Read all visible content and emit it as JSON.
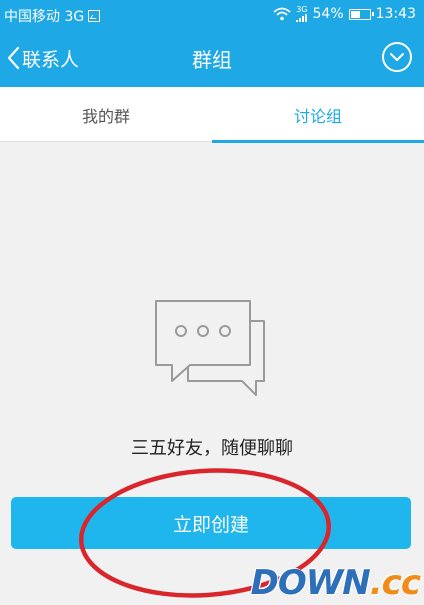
{
  "status_bar": {
    "carrier": "中国移动 3G",
    "net_type": "3G",
    "battery": "54%",
    "time": "13:43"
  },
  "header": {
    "back_label": "联系人",
    "title": "群组"
  },
  "tabs": [
    {
      "label": "我的群",
      "active": false
    },
    {
      "label": "讨论组",
      "active": true
    }
  ],
  "empty_state": {
    "message": "三五好友，随便聊聊",
    "icon": "chat-bubbles-icon"
  },
  "create_button": {
    "label": "立即创建"
  },
  "watermark": {
    "main": "DOWN",
    "suffix": ".cc"
  },
  "colors": {
    "primary": "#1fa8e6",
    "button": "#1fb6ee",
    "annotation": "#d9262c",
    "background": "#f1f1f1"
  }
}
